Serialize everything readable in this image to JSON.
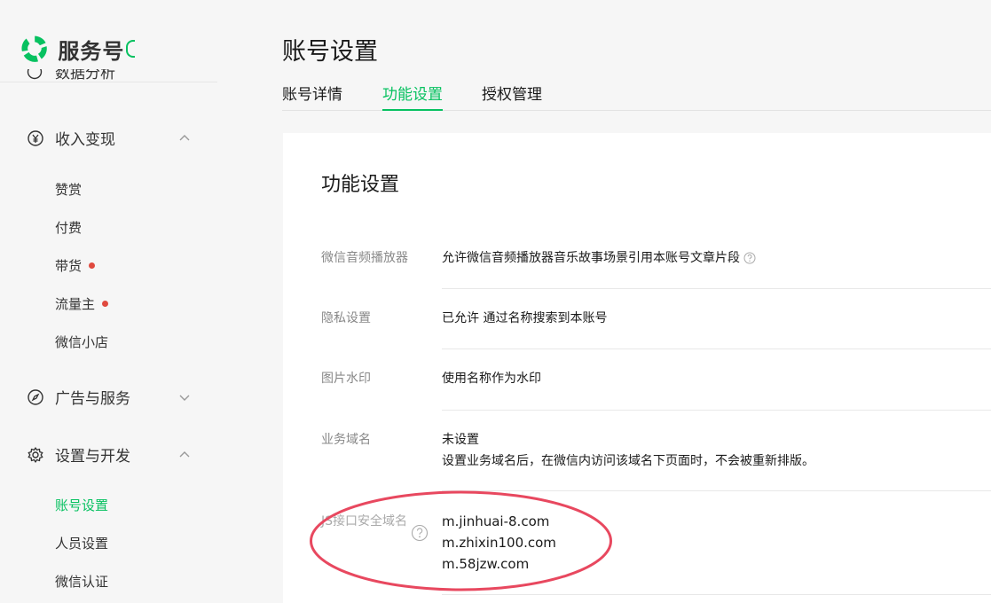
{
  "brand": {
    "name": "服务号"
  },
  "sidebar": {
    "cut_item_label": "数据分析",
    "groups": [
      {
        "label": "收入变现",
        "icon": "yen-icon"
      },
      {
        "label": "广告与服务",
        "icon": "compass-icon"
      },
      {
        "label": "设置与开发",
        "icon": "gear-icon"
      }
    ],
    "income_items": [
      "赞赏",
      "付费",
      "带货",
      "流量主",
      "微信小店"
    ],
    "settings_items": [
      "账号设置",
      "人员设置",
      "微信认证"
    ]
  },
  "header": {
    "title": "账号设置",
    "tabs": [
      "账号详情",
      "功能设置",
      "授权管理"
    ]
  },
  "card": {
    "title": "功能设置",
    "rows": [
      {
        "label": "微信音频播放器",
        "value": "允许微信音频播放器音乐故事场景引用本账号文章片段"
      },
      {
        "label": "隐私设置",
        "value": "已允许 通过名称搜索到本账号"
      },
      {
        "label": "图片水印",
        "value": "使用名称作为水印"
      },
      {
        "label": "业务域名",
        "value": "未设置",
        "note": "设置业务域名后，在微信内访问该域名下页面时，不会被重新排版。"
      },
      {
        "label": "JS接口安全域名",
        "domains": [
          "m.jinhuai-8.com",
          "m.zhixin100.com",
          "m.58jzw.com"
        ]
      }
    ]
  },
  "colors": {
    "accent": "#07c160",
    "badge": "#e04a3f",
    "annotation": "#e8485f"
  }
}
